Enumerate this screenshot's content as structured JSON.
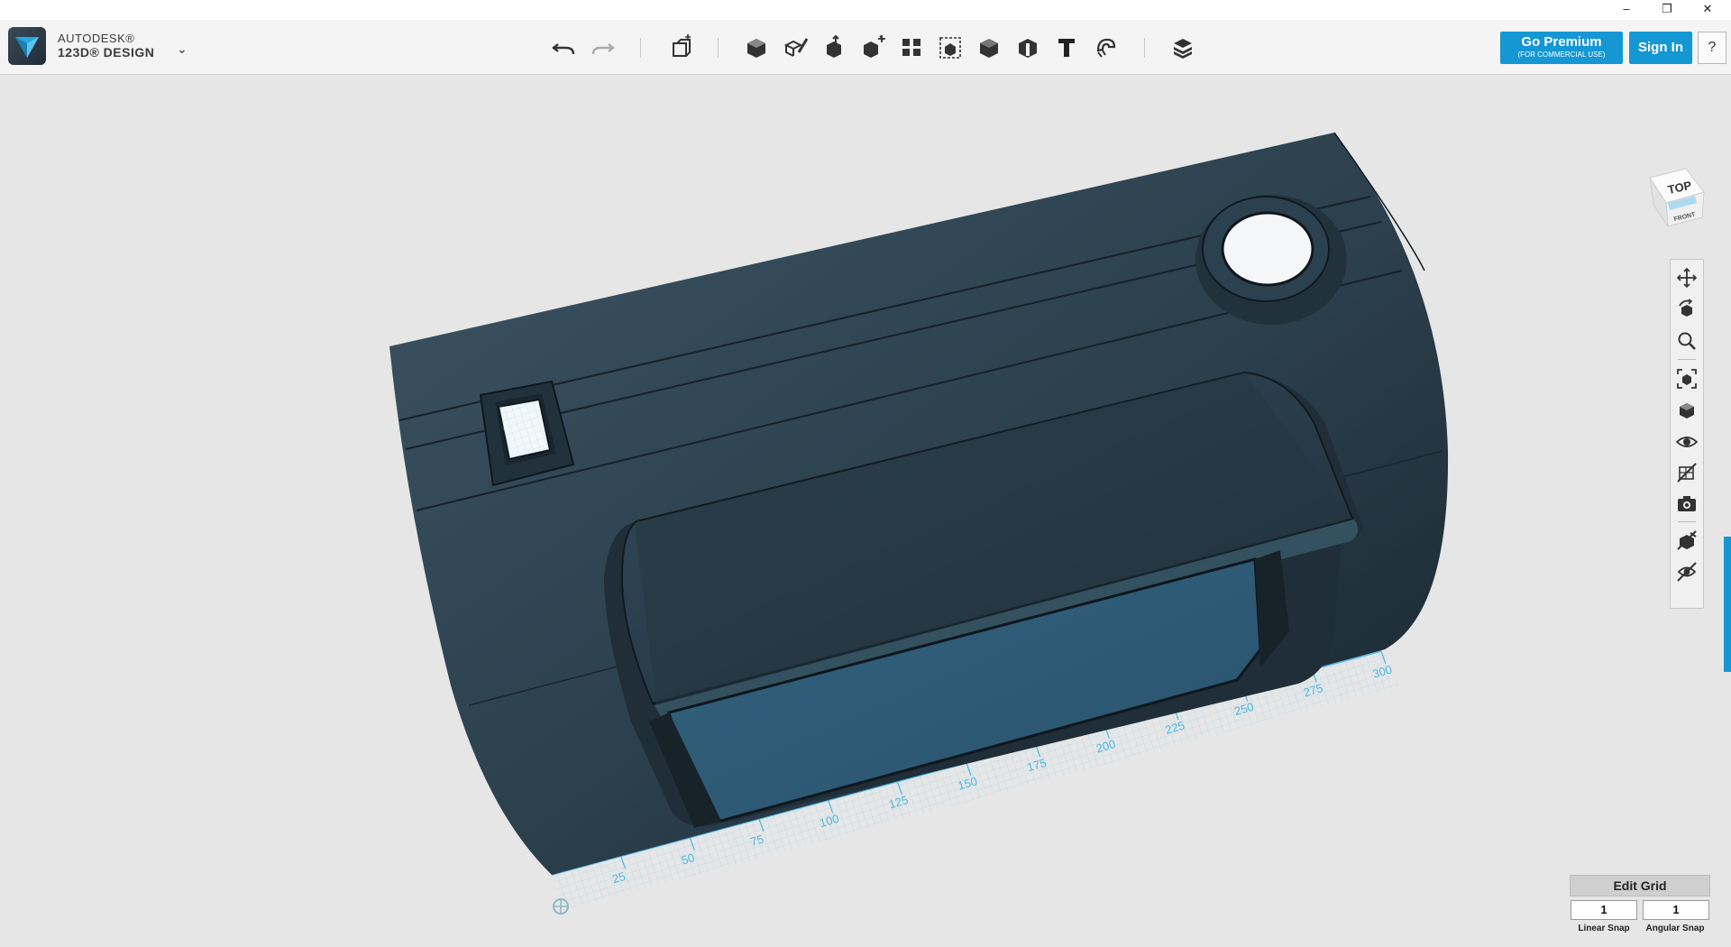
{
  "window": {
    "minimize_glyph": "–",
    "restore_glyph": "❐",
    "close_glyph": "✕"
  },
  "app": {
    "brand_line1": "AUTODESK®",
    "brand_line2": "123D® DESIGN",
    "menu_arrow": "⌄"
  },
  "toolbar": {
    "icons": [
      "undo-icon",
      "redo-icon",
      "transform-icon",
      "primitives-icon",
      "sketch-icon",
      "construct-icon",
      "modify-icon",
      "pattern-icon",
      "grouping-icon",
      "combine-icon",
      "measure-icon",
      "text-icon",
      "snap-icon",
      "material-icon"
    ]
  },
  "header": {
    "premium_label": "Go Premium",
    "premium_sub": "(FOR COMMERCIAL USE)",
    "signin_label": "Sign In",
    "help_label": "?"
  },
  "viewcube": {
    "top_label": "TOP",
    "front_label": "FRONT"
  },
  "navigation": {
    "icons": [
      "pan-icon",
      "orbit-icon",
      "zoom-icon",
      "fit-icon",
      "views-icon",
      "visibility-icon",
      "hide-sketch-icon",
      "screenshot-icon",
      "materials-visibility-icon",
      "outlines-icon"
    ]
  },
  "ruler": {
    "ticks": [
      "25",
      "50",
      "75",
      "100",
      "125",
      "150",
      "175",
      "200",
      "225",
      "250",
      "275",
      "300"
    ]
  },
  "grid_panel": {
    "edit_grid_label": "Edit Grid",
    "linear_snap_value": "1",
    "angular_snap_value": "1",
    "linear_snap_label": "Linear Snap",
    "angular_snap_label": "Angular Snap"
  },
  "colors": {
    "accent": "#1597d4",
    "model": "#2b3f4c",
    "screen": "#2f5b76",
    "grid": "#4ab7e3"
  }
}
